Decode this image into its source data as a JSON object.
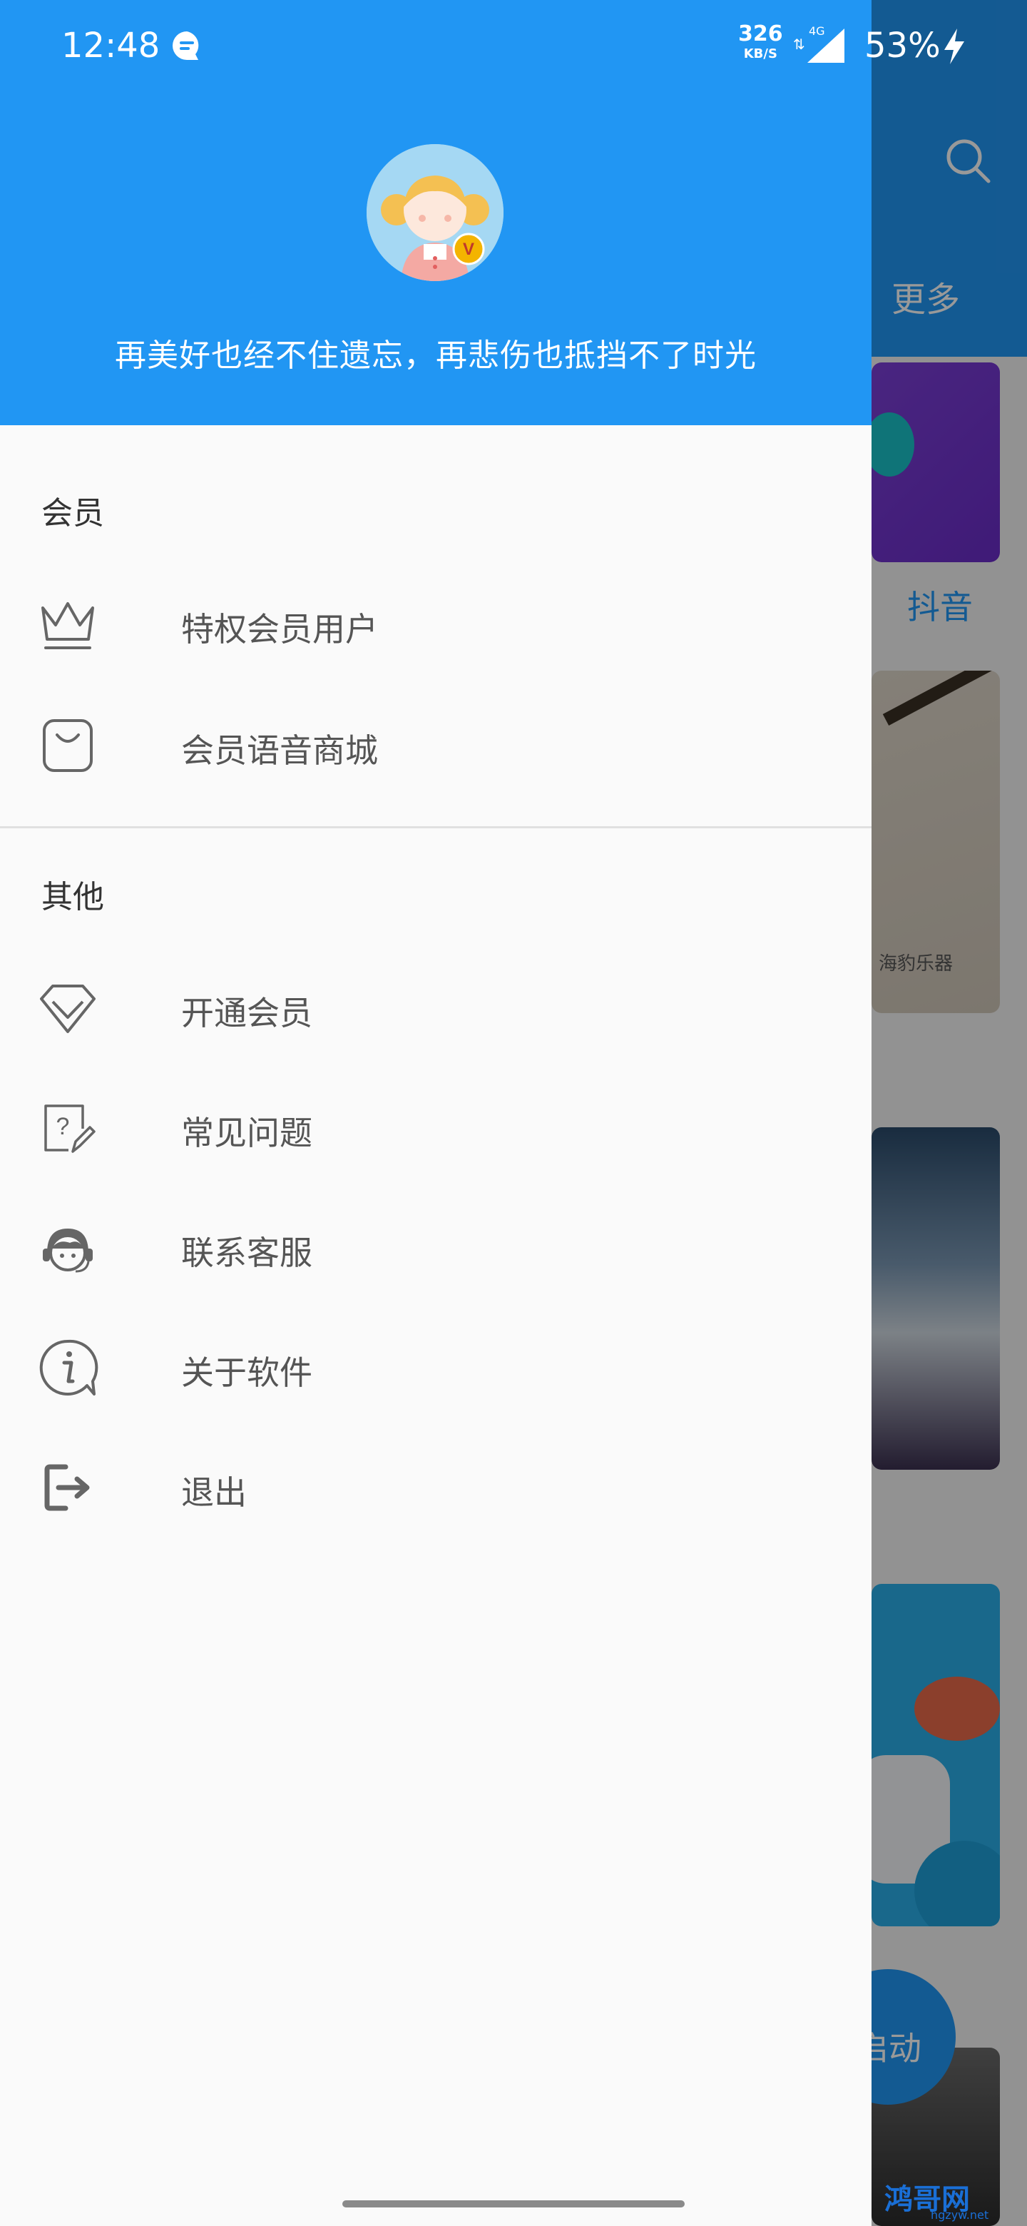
{
  "status_bar": {
    "time": "12:48",
    "net_speed": "326",
    "net_unit": "KB/S",
    "net_type": "4G",
    "battery": "53%"
  },
  "background": {
    "more_tab": "更多",
    "douyin_label": "抖音",
    "fab_label": "启动",
    "card2_logo": "海豹乐器",
    "watermark": "鸿哥网",
    "watermark_sub": "hgzyw.net"
  },
  "drawer": {
    "motto": "再美好也经不住遗忘，再悲伤也抵挡不了时光",
    "sections": [
      {
        "title": "会员",
        "items": [
          {
            "label": "特权会员用户",
            "icon": "crown-icon"
          },
          {
            "label": "会员语音商城",
            "icon": "shopping-bag-icon"
          }
        ]
      },
      {
        "title": "其他",
        "items": [
          {
            "label": "开通会员",
            "icon": "diamond-icon"
          },
          {
            "label": "常见问题",
            "icon": "question-edit-icon"
          },
          {
            "label": "联系客服",
            "icon": "customer-service-icon"
          },
          {
            "label": "关于软件",
            "icon": "info-icon"
          },
          {
            "label": "退出",
            "icon": "logout-icon"
          }
        ]
      }
    ]
  },
  "colors": {
    "primary": "#2196f3",
    "drawer_bg": "#fafafa",
    "icon_gray": "#666666"
  }
}
